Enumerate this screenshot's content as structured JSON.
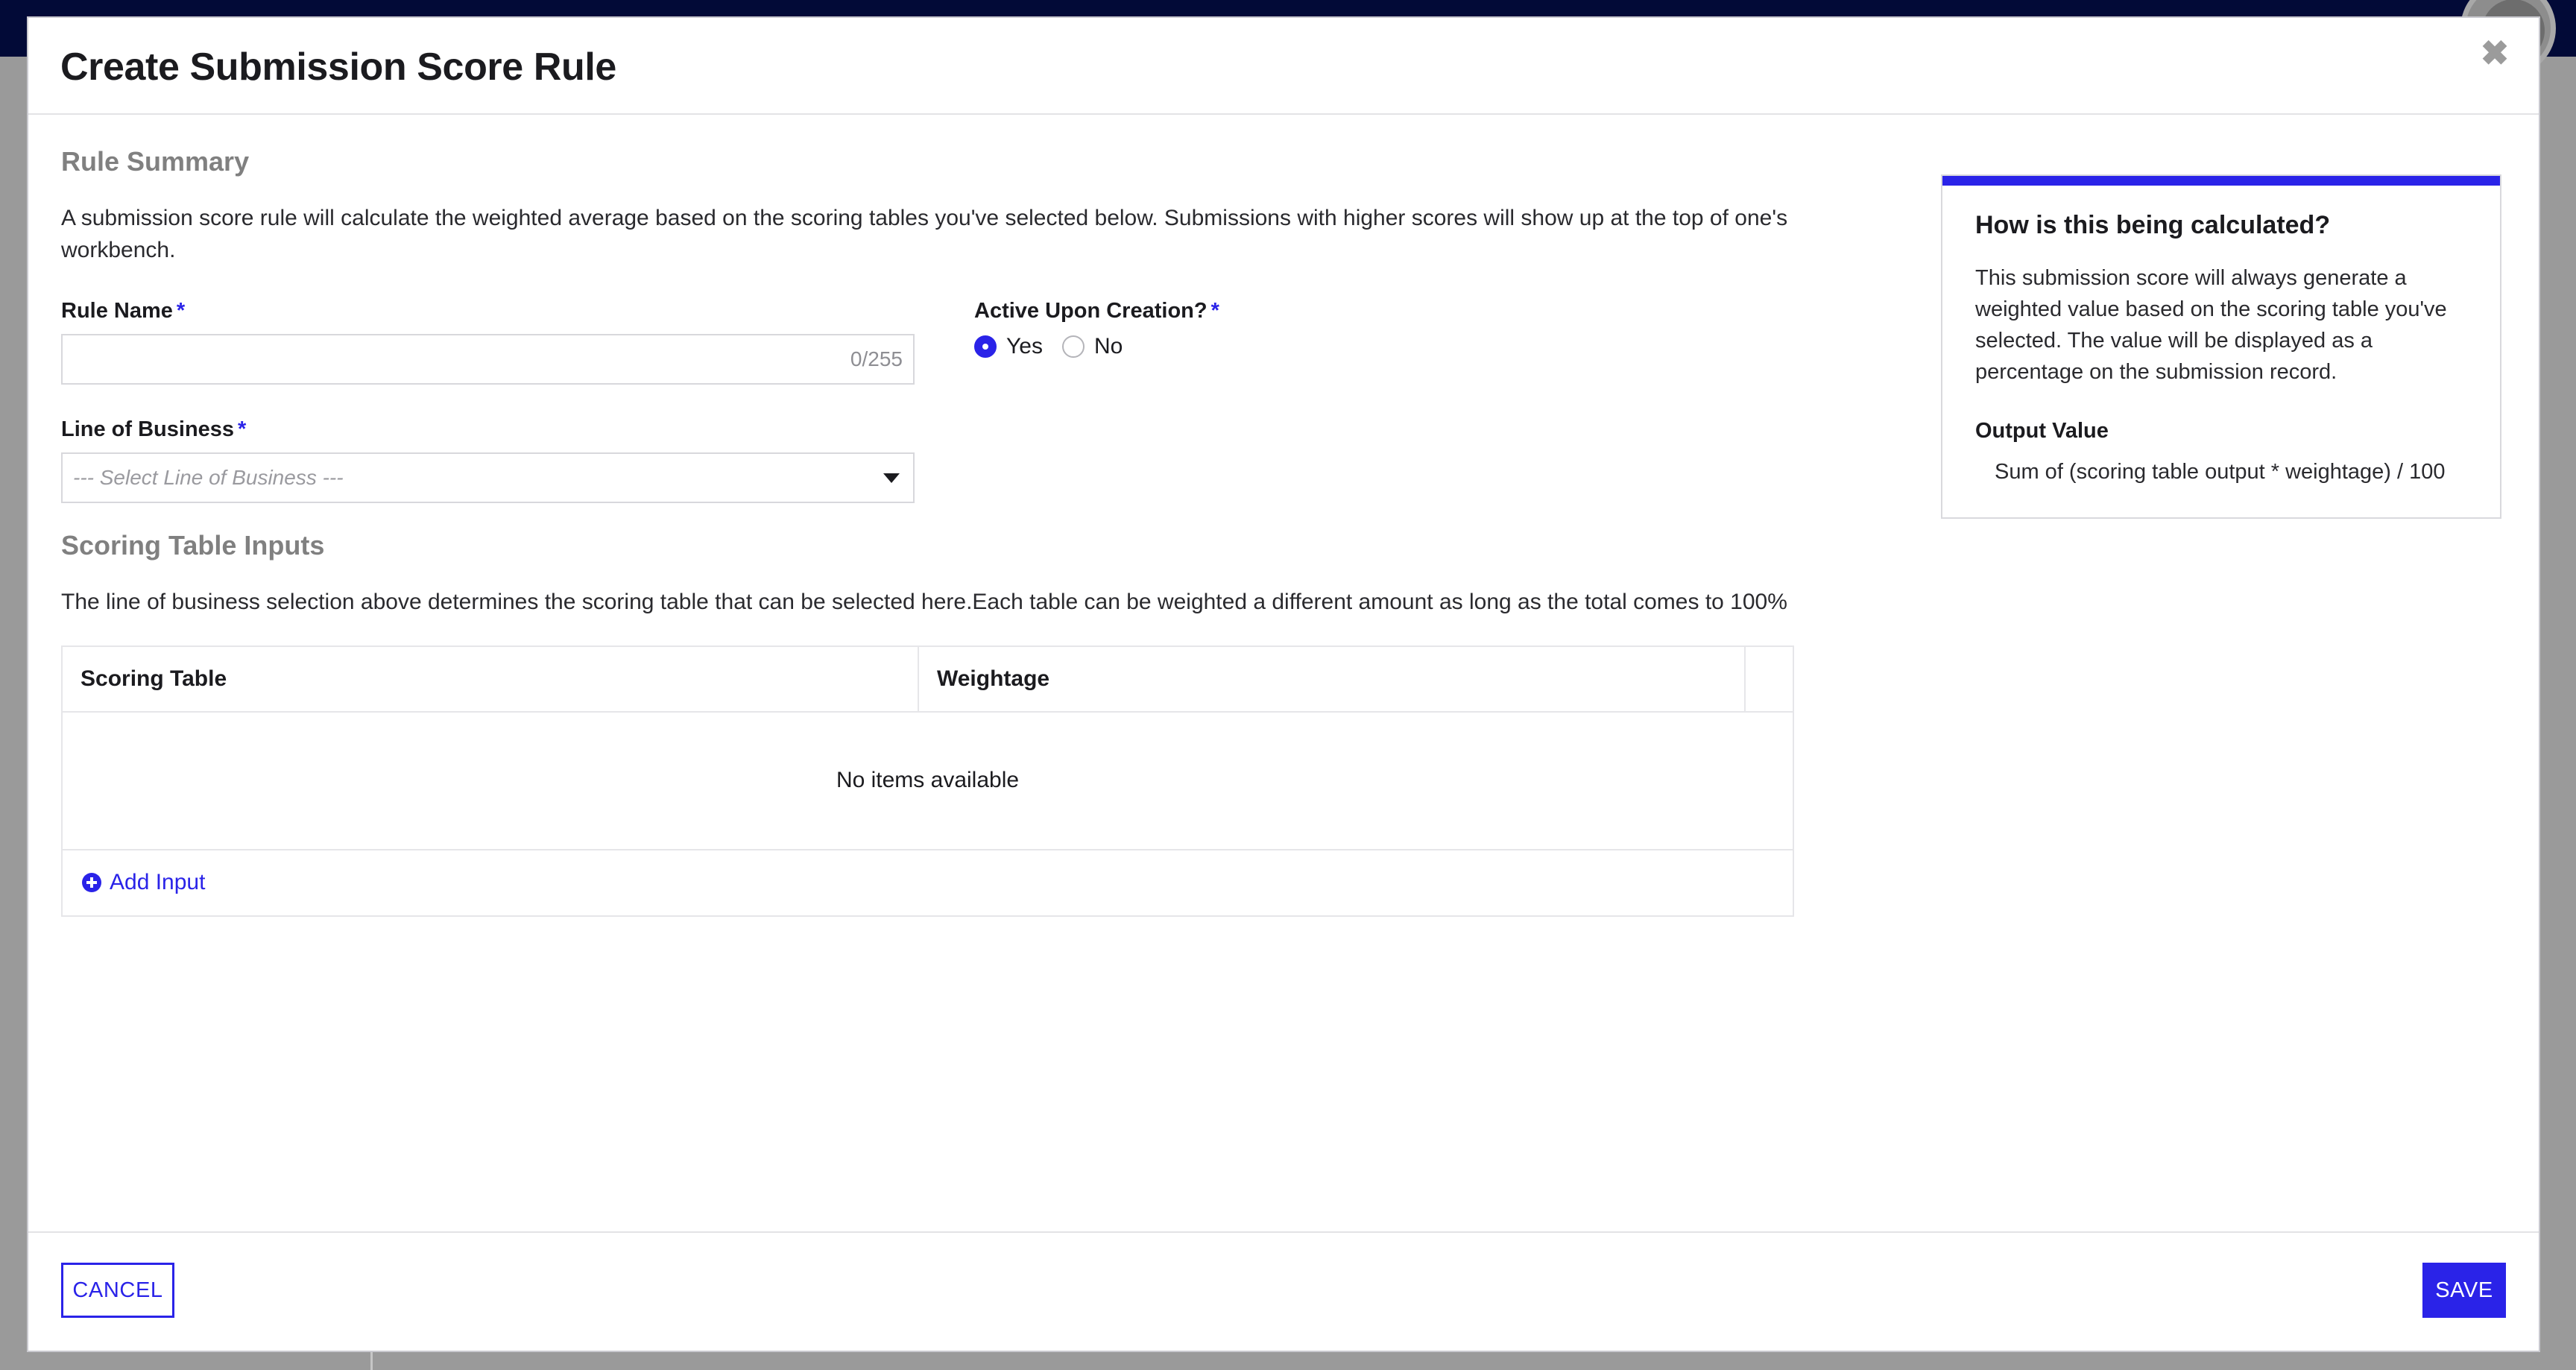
{
  "modal": {
    "title": "Create Submission Score Rule",
    "close_icon": "close-icon"
  },
  "rule_summary": {
    "heading": "Rule Summary",
    "description": "A submission score rule will calculate the weighted average based on the scoring tables you've selected below. Submissions with higher scores will show up at the top of one's workbench."
  },
  "form": {
    "rule_name": {
      "label": "Rule Name",
      "required_marker": "*",
      "value": "",
      "placeholder": "",
      "char_count": "0/255"
    },
    "active_upon_creation": {
      "label": "Active Upon Creation?",
      "required_marker": "*",
      "selected": "Yes",
      "options": [
        {
          "label": "Yes",
          "checked": true
        },
        {
          "label": "No",
          "checked": false
        }
      ]
    },
    "line_of_business": {
      "label": "Line of Business",
      "required_marker": "*",
      "placeholder": "--- Select Line of Business ---",
      "caret_icon": "chevron-down-icon"
    }
  },
  "scoring_table_inputs": {
    "heading": "Scoring Table Inputs",
    "description": "The line of business selection above determines the scoring table that can be selected here.Each table can be weighted a different amount as long as the total comes to 100%",
    "table": {
      "columns": [
        "Scoring Table",
        "Weightage",
        ""
      ],
      "rows": [],
      "empty_message": "No items available"
    },
    "add_input_label": "Add Input",
    "add_input_icon": "plus-circle-icon"
  },
  "info_panel": {
    "title": "How is this being calculated?",
    "body": "This submission score will always generate a weighted value based on the scoring table you've selected. The value will be displayed as a percentage on the submission record.",
    "output_label": "Output Value",
    "formula": "Sum of (scoring table output * weightage) / 100",
    "accent_color": "#2a23e8"
  },
  "footer": {
    "cancel_label": "CANCEL",
    "save_label": "SAVE"
  },
  "theme": {
    "accent": "#2a23e8",
    "topbar": "#020a37",
    "overlay": "#9a9a9a"
  }
}
